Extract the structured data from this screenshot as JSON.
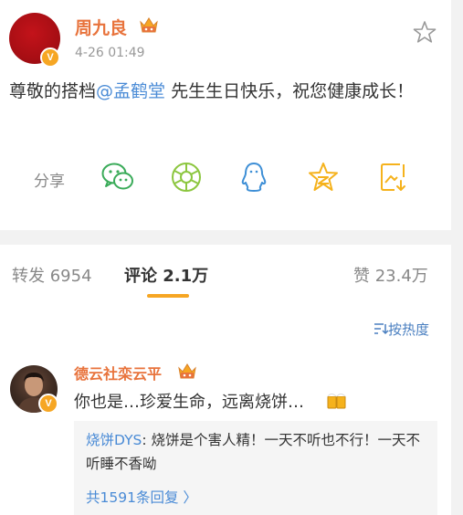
{
  "post": {
    "author": "周九良",
    "time": "4-26 01:49",
    "verified_badge": "V",
    "text_before": "尊敬的搭档",
    "mention": "@孟鹤堂",
    "text_after": " 先生生日快乐，祝您健康成长！",
    "share_label": "分享",
    "share_icons": [
      "wechat-icon",
      "moments-icon",
      "qq-icon",
      "qzone-icon",
      "save-image-icon"
    ]
  },
  "tabs": {
    "repost": "转发 6954",
    "comment": "评论 2.1万",
    "like": "赞 23.4万"
  },
  "sort_label": "按热度",
  "comment": {
    "author": "德云社栾云平",
    "verified_badge": "V",
    "text": "你也是…珍爱生命，远离烧饼…",
    "reply": {
      "user": "烧饼DYS",
      "text": ": 烧饼是个害人精！一天不听也不行！一天不听睡不香呦",
      "more": "共1591条回复 〉"
    }
  },
  "colors": {
    "username": "#e8733c",
    "link": "#4a8bd6",
    "accent": "#f6a623",
    "share_green": "#3aab59",
    "share_blue": "#3e8fd6",
    "share_yellow": "#f5b21c"
  }
}
